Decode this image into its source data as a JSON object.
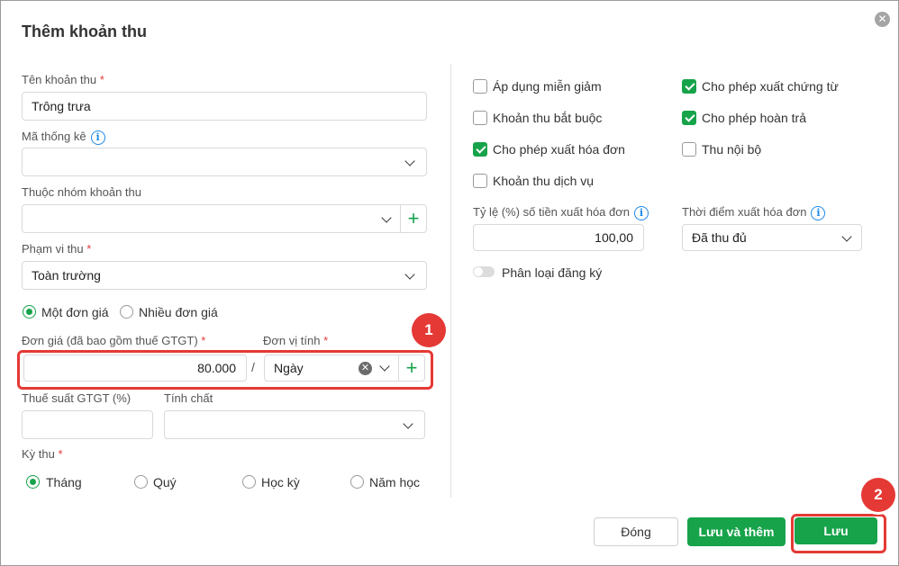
{
  "dialog": {
    "title": "Thêm khoản thu",
    "close_label": "✕"
  },
  "left": {
    "name_label": "Tên khoản thu",
    "name_value": "Trông trưa",
    "stat_code_label": "Mã thống kê",
    "group_label": "Thuộc nhóm khoản thu",
    "scope_label": "Phạm vi thu",
    "scope_value": "Toàn trường",
    "price_mode_options": [
      "Một đơn giá",
      "Nhiều đơn giá"
    ],
    "price_mode_selected": "Một đơn giá",
    "unit_price_label": "Đơn giá (đã bao gồm thuế GTGT)",
    "unit_price_value": "80.000",
    "slash": "/",
    "unit_label": "Đơn vị tính",
    "unit_value": "Ngày",
    "vat_label": "Thuế suất GTGT (%)",
    "nature_label": "Tính chất",
    "period_label": "Kỳ thu",
    "period_options": [
      "Tháng",
      "Quý",
      "Học kỳ",
      "Năm học"
    ],
    "period_selected": "Tháng",
    "required_mark": "*",
    "info_glyph": "i",
    "plus_glyph": "+",
    "clear_glyph": "✕"
  },
  "right": {
    "checkboxes": [
      {
        "label": "Áp dụng miễn giảm",
        "checked": false
      },
      {
        "label": "Cho phép xuất chứng từ",
        "checked": true
      },
      {
        "label": "Khoản thu bắt buộc",
        "checked": false
      },
      {
        "label": "Cho phép hoàn trả",
        "checked": true
      },
      {
        "label": "Cho phép xuất hóa đơn",
        "checked": true
      },
      {
        "label": "Thu nội bộ",
        "checked": false
      },
      {
        "label": "Khoản thu dịch vụ",
        "checked": false
      }
    ],
    "invoice_rate_label": "Tỷ lệ (%) số tiền xuất hóa đơn",
    "invoice_rate_value": "100,00",
    "invoice_time_label": "Thời điểm xuất hóa đơn",
    "invoice_time_value": "Đã thu đủ",
    "registration_toggle_label": "Phân loại đăng ký",
    "registration_toggle_on": false
  },
  "footer": {
    "close_label": "Đóng",
    "save_add_label": "Lưu và thêm",
    "save_label": "Lưu"
  },
  "annotations": {
    "badge1": "1",
    "badge2": "2"
  },
  "colors": {
    "accent": "#16a34a",
    "highlight": "#e53935",
    "info": "#1e88e5"
  }
}
